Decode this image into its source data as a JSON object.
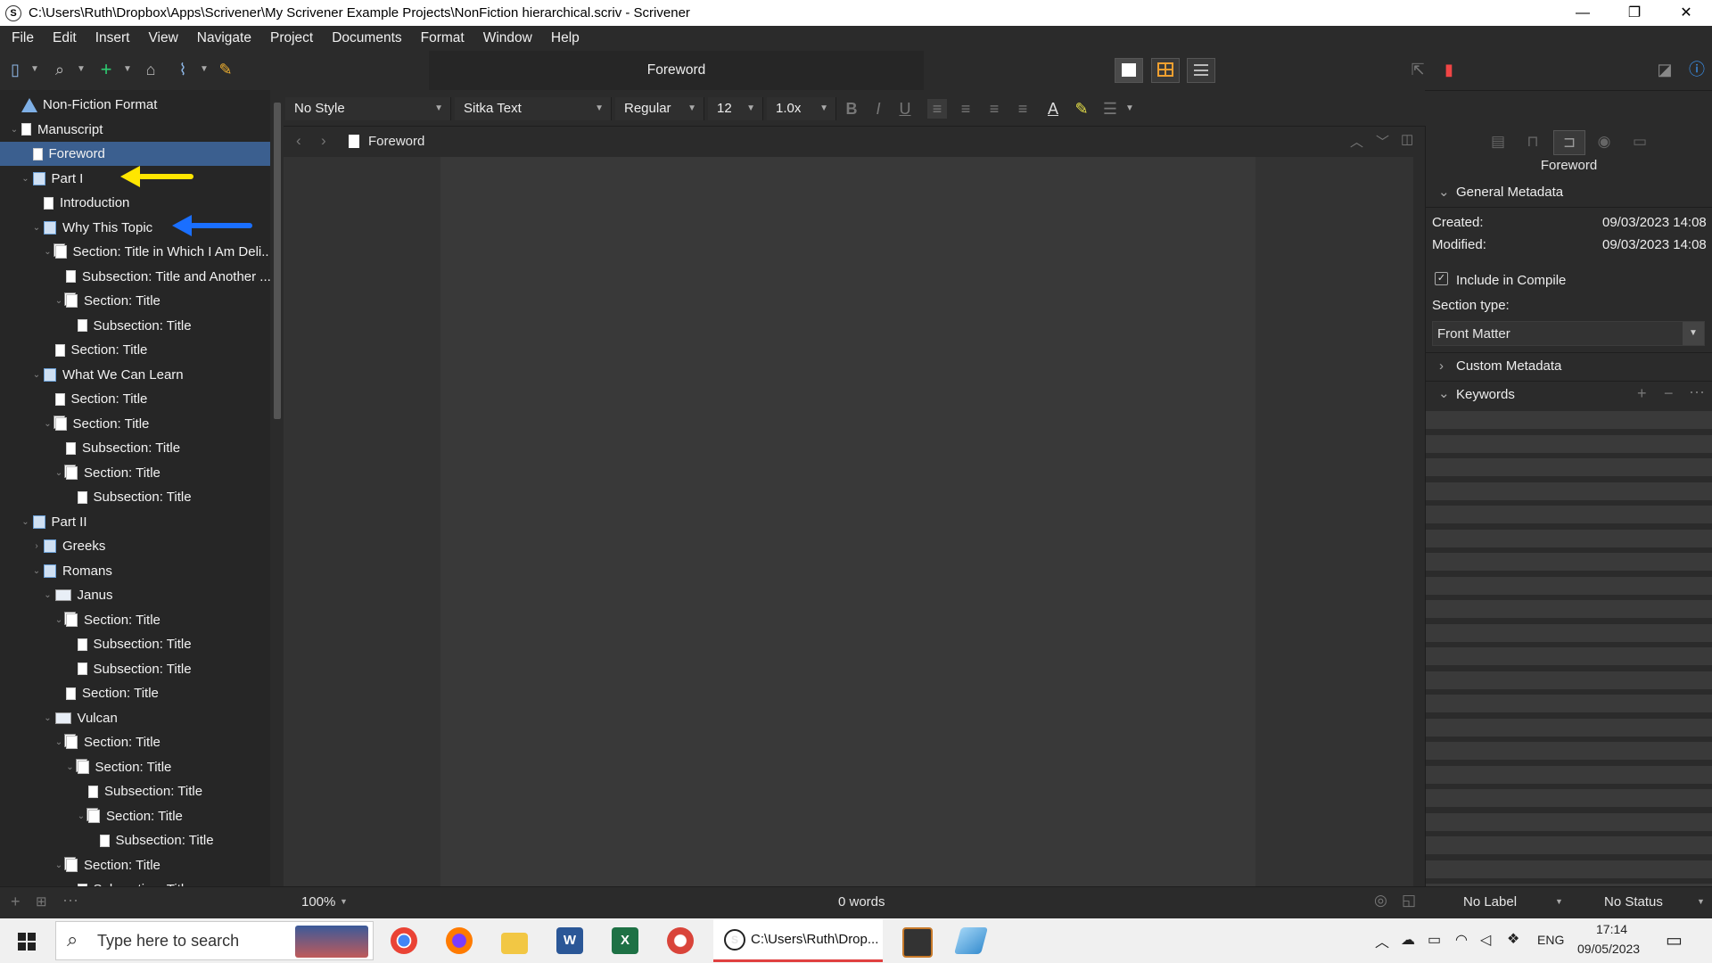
{
  "window": {
    "title": "C:\\Users\\Ruth\\Dropbox\\Apps\\Scrivener\\My Scrivener Example Projects\\NonFiction hierarchical.scriv - Scrivener",
    "app_icon_letter": "S",
    "minimize": "—",
    "maximize": "❐",
    "close": "✕"
  },
  "menu": [
    "File",
    "Edit",
    "Insert",
    "View",
    "Navigate",
    "Project",
    "Documents",
    "Format",
    "Window",
    "Help"
  ],
  "toolbar": {
    "document_title": "Foreword"
  },
  "binder": {
    "items": [
      {
        "label": "Non-Fiction Format",
        "level": 0,
        "icon": "warning-icon",
        "chevron": ""
      },
      {
        "label": "Manuscript",
        "level": 0,
        "icon": "doc-icon",
        "chevron": "⌄"
      },
      {
        "label": "Foreword",
        "level": 1,
        "icon": "doc-icon",
        "chevron": "",
        "selected": true
      },
      {
        "label": "Part I",
        "level": 1,
        "icon": "part-icon",
        "chevron": "⌄"
      },
      {
        "label": "Introduction",
        "level": 2,
        "icon": "doc-icon",
        "chevron": ""
      },
      {
        "label": "Why This Topic",
        "level": 2,
        "icon": "part-icon",
        "chevron": "⌄"
      },
      {
        "label": "Section: Title in Which I Am Deli...",
        "level": 3,
        "icon": "stack-icon",
        "chevron": "⌄"
      },
      {
        "label": "Subsection: Title and Another ...",
        "level": 4,
        "icon": "doc-icon",
        "chevron": ""
      },
      {
        "label": "Section: Title",
        "level": 4,
        "icon": "stack-icon",
        "chevron": "⌄"
      },
      {
        "label": "Subsection: Title",
        "level": 5,
        "icon": "doc-icon",
        "chevron": ""
      },
      {
        "label": "Section: Title",
        "level": 3,
        "icon": "doc-icon",
        "chevron": ""
      },
      {
        "label": "What We Can Learn",
        "level": 2,
        "icon": "part-icon",
        "chevron": "⌄"
      },
      {
        "label": "Section: Title",
        "level": 3,
        "icon": "doc-icon",
        "chevron": ""
      },
      {
        "label": "Section: Title",
        "level": 3,
        "icon": "stack-icon",
        "chevron": "⌄"
      },
      {
        "label": "Subsection: Title",
        "level": 4,
        "icon": "doc-icon",
        "chevron": ""
      },
      {
        "label": "Section: Title",
        "level": 4,
        "icon": "stack-icon",
        "chevron": "⌄"
      },
      {
        "label": "Subsection: Title",
        "level": 5,
        "icon": "doc-icon",
        "chevron": ""
      },
      {
        "label": "Part II",
        "level": 1,
        "icon": "part-icon",
        "chevron": "⌄"
      },
      {
        "label": "Greeks",
        "level": 2,
        "icon": "part-icon",
        "chevron": "›"
      },
      {
        "label": "Romans",
        "level": 2,
        "icon": "part-icon",
        "chevron": "⌄"
      },
      {
        "label": "Janus",
        "level": 3,
        "icon": "folder-icon",
        "chevron": "⌄"
      },
      {
        "label": "Section: Title",
        "level": 4,
        "icon": "stack-icon",
        "chevron": "⌄"
      },
      {
        "label": "Subsection: Title",
        "level": 5,
        "icon": "doc-icon",
        "chevron": ""
      },
      {
        "label": "Subsection: Title",
        "level": 5,
        "icon": "doc-icon",
        "chevron": ""
      },
      {
        "label": "Section: Title",
        "level": 4,
        "icon": "doc-icon",
        "chevron": ""
      },
      {
        "label": "Vulcan",
        "level": 3,
        "icon": "folder-icon",
        "chevron": "⌄"
      },
      {
        "label": "Section: Title",
        "level": 4,
        "icon": "stack-icon",
        "chevron": "⌄"
      },
      {
        "label": "Section: Title",
        "level": 5,
        "icon": "stack-icon",
        "chevron": "⌄"
      },
      {
        "label": "Subsection: Title",
        "level": 6,
        "icon": "doc-icon",
        "chevron": ""
      },
      {
        "label": "Section: Title",
        "level": 6,
        "icon": "stack-icon",
        "chevron": "⌄"
      },
      {
        "label": "Subsection: Title",
        "level": 7,
        "icon": "doc-icon",
        "chevron": ""
      },
      {
        "label": "Section: Title",
        "level": 4,
        "icon": "stack-icon",
        "chevron": "⌄"
      },
      {
        "label": "Subsection: Title",
        "level": 5,
        "icon": "doc-icon",
        "chevron": ""
      }
    ]
  },
  "format_bar": {
    "style": "No Style",
    "font": "Sitka Text",
    "weight": "Regular",
    "size": "12",
    "spacing": "1.0x"
  },
  "editor": {
    "header_title": "Foreword"
  },
  "inspector": {
    "title": "Foreword",
    "general_metadata": "General Metadata",
    "created_label": "Created:",
    "created_value": "09/03/2023 14:08",
    "modified_label": "Modified:",
    "modified_value": "09/03/2023 14:08",
    "include_in_compile": "Include in Compile",
    "section_type_label": "Section type:",
    "section_type_value": "Front Matter",
    "custom_metadata": "Custom Metadata",
    "keywords": "Keywords"
  },
  "footer": {
    "zoom": "100%",
    "word_count": "0 words",
    "label": "No Label",
    "status": "No Status"
  },
  "taskbar": {
    "search_placeholder": "Type here to search",
    "active_window": "C:\\Users\\Ruth\\Drop...",
    "language": "ENG",
    "time": "17:14",
    "date": "09/05/2023"
  },
  "colors": {
    "selection": "#3b5f8f",
    "arrow_yellow": "#ffe600",
    "arrow_blue": "#1a6fff",
    "arrow_red": "#ff2a3a"
  }
}
